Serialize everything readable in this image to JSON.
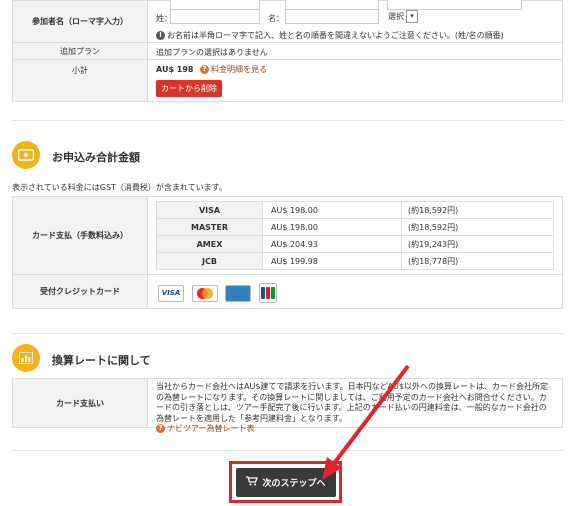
{
  "participant": {
    "label": "参加者名（ローマ字入力）",
    "surname_label": "姓：",
    "given_label": "名：",
    "title_select": "選択",
    "note": "お名前は半角ローマ字で記入、姓と名の順番を間違えないようご注意ください。(姓/名の順番)"
  },
  "plan": {
    "label": "追加プラン",
    "value": "追加プランの選択はありません"
  },
  "subtotal": {
    "label": "小計",
    "value": "AU$ 198",
    "detail_link": "料金明細を見る"
  },
  "remove_button": "カートから削除",
  "total_section": {
    "title": "お申込み合計金額",
    "gst_note": "表示されている料金にはGST（消費税）が含まれています。",
    "card_label": "カード支払（手数料込み）",
    "rows": [
      {
        "brand": "VISA",
        "amount": "AU$ 198.00",
        "yen": "(約18,592円)"
      },
      {
        "brand": "MASTER",
        "amount": "AU$ 198.00",
        "yen": "(約18,592円)"
      },
      {
        "brand": "AMEX",
        "amount": "AU$ 204.93",
        "yen": "(約19,243円)"
      },
      {
        "brand": "JCB",
        "amount": "AU$ 199.98",
        "yen": "(約18,778円)"
      }
    ],
    "accepted_label": "受付クレジットカード",
    "accepted_cards": [
      "VISA",
      "MasterCard",
      "AMEX",
      "JCB"
    ]
  },
  "rate_section": {
    "title": "換算レートに関して",
    "label": "カード支払い",
    "text": "当社からカード会社へはAU$建てで請求を行います。日本円などAU$以外への換算レートは、カード会社所定の為替レートになります。その換算レートに関しましては、ご利用予定のカード会社へお問合せください。カードの引き落としは、ツアー手配完了後に行います。上記のカード払いの円建料金は、一般的なカード会社の為替レートを適用した「参考円建料金」となります。",
    "link": "ナビツアー為替レート表"
  },
  "next_button": "次のステップへ",
  "colors": {
    "accent": "#f2b21c",
    "danger": "#d9342b",
    "dark": "#333333"
  }
}
